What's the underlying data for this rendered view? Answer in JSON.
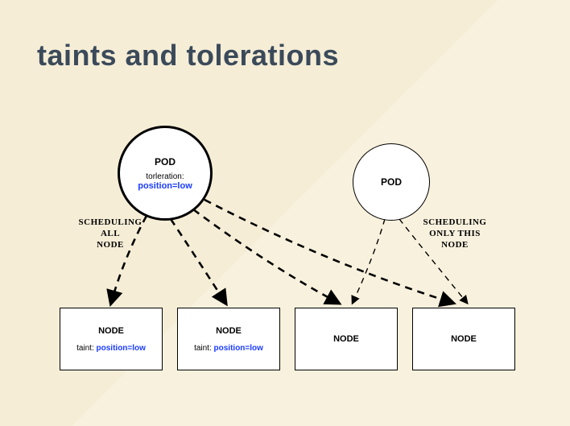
{
  "title": "taints and tolerations",
  "pods": {
    "left": {
      "label": "POD",
      "subLabel": "torleration:",
      "value": "position=low"
    },
    "right": {
      "label": "POD"
    }
  },
  "annotations": {
    "left": "SCHEDULING\nALL\nNODE",
    "right": "SCHEDULING\nONLY THIS\nNODE"
  },
  "nodes": [
    {
      "label": "NODE",
      "taintLabel": "taint: ",
      "taintValue": "position=low"
    },
    {
      "label": "NODE",
      "taintLabel": "taint: ",
      "taintValue": "position=low"
    },
    {
      "label": "NODE",
      "taintLabel": "",
      "taintValue": ""
    },
    {
      "label": "NODE",
      "taintLabel": "",
      "taintValue": ""
    }
  ]
}
